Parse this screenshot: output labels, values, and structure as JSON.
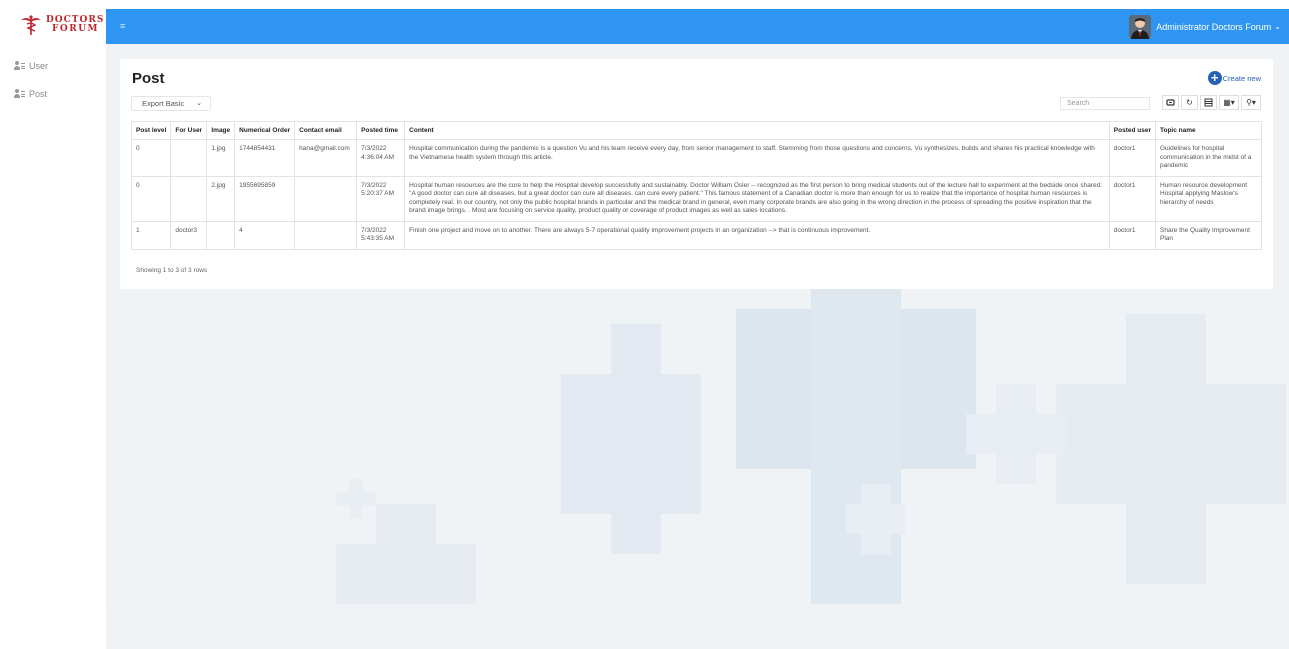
{
  "logo": {
    "line1": "DOCTORS",
    "line2": "FORUM"
  },
  "sidebar": {
    "items": [
      {
        "label": "User"
      },
      {
        "label": "Post"
      }
    ]
  },
  "topbar": {
    "menu_icon": "≡",
    "user_name": "Administrator Doctors Forum"
  },
  "page": {
    "title": "Post",
    "create_label": "Create new"
  },
  "toolbar": {
    "export_value": "Export Basic",
    "search_placeholder": "Search"
  },
  "table": {
    "columns": [
      "Post level",
      "For User",
      "Image",
      "Numerical Order",
      "Contact email",
      "Posted time",
      "Content",
      "Posted user",
      "Topic name"
    ],
    "rows": [
      {
        "post_level": "0",
        "for_user": "",
        "image": "1.jpg",
        "order": "1744854431",
        "email": "hana@gmail.com",
        "time": "7/3/2022 4:36:04 AM",
        "content": "Hospital communication during the pandemic is a question Vu and his team receive every day, from senior management to staff. Stemming from those questions and concerns, Vu synthesizes, builds and shares his practical knowledge with the Vietnamese health system through this article.",
        "user": "doctor1",
        "topic": "Guidelines for hospital communication in the midst of a pandemic"
      },
      {
        "post_level": "0",
        "for_user": "",
        "image": "2.jpg",
        "order": "1955695859",
        "email": "",
        "time": "7/3/2022 5:20:37 AM",
        "content": "Hospital human resources are the core to help the Hospital develop successfully and sustainably. Doctor William Osler -- recognized as the first person to bring medical students out of the lecture hall to experiment at the bedside once shared: \"A good doctor can cure all diseases, but a great doctor can cure all diseases. can cure every patient.\" This famous statement of a Canadian doctor is more than enough for us to realize that the importance of hospital human resources is completely real. In our country, not only the public hospital brands in particular and the medical brand in general, even many corporate brands are also going in the wrong direction in the process of spreading the positive inspiration that the brand image brings. . Most are focusing on service quality, product quality or coverage of product images as well as sales locations.",
        "user": "doctor1",
        "topic": "Human resource development Hospital applying Maslow's hierarchy of needs"
      },
      {
        "post_level": "1",
        "for_user": "doctor3",
        "image": "",
        "order": "4",
        "email": "",
        "time": "7/3/2022 5:43:35 AM",
        "content": "Finish one project and move on to another. There are always 5-7 operational quality improvement projects in an organization --> that is continuous improvement.",
        "user": "doctor1",
        "topic": "Share the Quality Improvement Plan"
      }
    ],
    "footer": "Showing 1 to 3 of 3 rows"
  }
}
